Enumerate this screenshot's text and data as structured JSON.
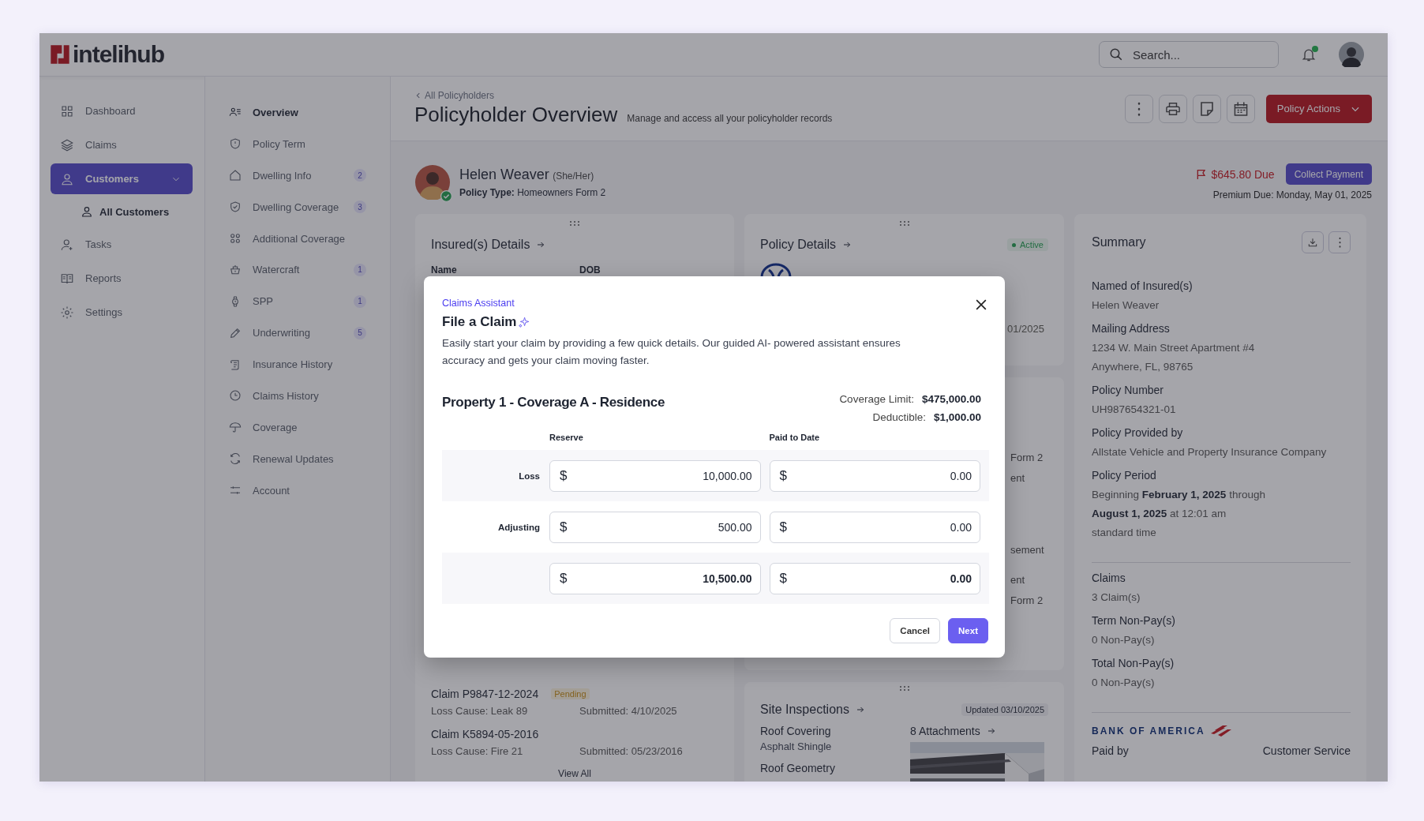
{
  "topbar": {
    "logo": "intelihub",
    "search": {
      "placeholder": "Search..."
    },
    "notifications": true
  },
  "sidebar": {
    "items": [
      {
        "label": "Dashboard",
        "selected": false,
        "expanded": false
      },
      {
        "label": "Claims",
        "selected": false,
        "expanded": false
      },
      {
        "label": "Customers",
        "selected": true,
        "expanded": true,
        "children": [
          {
            "label": "All Customers",
            "selected": true
          }
        ]
      },
      {
        "label": "Tasks",
        "selected": false,
        "expanded": false
      },
      {
        "label": "Reports",
        "selected": false,
        "expanded": false
      },
      {
        "label": "Settings",
        "selected": false,
        "expanded": false
      }
    ]
  },
  "subnav": {
    "items": [
      {
        "label": "Overview",
        "selected": true
      },
      {
        "label": "Policy Term",
        "selected": false
      },
      {
        "label": "Dwelling Info",
        "selected": false,
        "badge": "2"
      },
      {
        "label": "Dwelling Coverage",
        "selected": false,
        "badge": "3"
      },
      {
        "label": "Additional Coverage",
        "selected": false
      },
      {
        "label": "Watercraft",
        "selected": false,
        "badge": "1"
      },
      {
        "label": "SPP",
        "selected": false,
        "badge": "1"
      },
      {
        "label": "Underwriting",
        "selected": false,
        "badge": "5"
      },
      {
        "label": "Insurance History",
        "selected": false
      },
      {
        "label": "Claims History",
        "selected": false
      },
      {
        "label": "Coverage",
        "selected": false
      },
      {
        "label": "Renewal Updates",
        "selected": false
      },
      {
        "label": "Account",
        "selected": false
      }
    ]
  },
  "header": {
    "breadcrumb": "All Policyholders",
    "title": "Policyholder Overview",
    "subtitle": "Manage and access all your policyholder records",
    "primary_action": "Policy Actions"
  },
  "policyholder": {
    "name": "Helen Weaver",
    "pronouns": "(She/Her)",
    "verified": true,
    "policy_type_label": "Policy Type:",
    "policy_type": "Homeowners Form 2",
    "amount_due": "$645.80 Due",
    "payment_button": "Collect Payment",
    "premium_due": "Premium Due: Monday, May 01, 2025"
  },
  "insured_card": {
    "title": "Insured(s) Details",
    "columns": [
      "Name",
      "DOB"
    ],
    "claims": [
      {
        "id": "Claim P9847-12-2024",
        "status": "Pending",
        "loss_cause": "Loss Cause: Leak 89",
        "submitted": "Submitted: 4/10/2025"
      },
      {
        "id": "Claim K5894-05-2016",
        "loss_cause": "Loss Cause: Fire 21",
        "submitted": "Submitted: 05/23/2016"
      }
    ],
    "view_all": "View All"
  },
  "policy_card": {
    "title": "Policy Details",
    "status": "Active",
    "visible_text": [
      "01/2025"
    ]
  },
  "coverage_card": {
    "visible_groups": [
      [
        "Form 2",
        "ent"
      ],
      [
        "sement"
      ],
      [
        "ent",
        "Form 2"
      ]
    ]
  },
  "inspections_card": {
    "title": "Site Inspections",
    "updated": "Updated 03/10/2025",
    "items": [
      {
        "label": "Roof Covering",
        "value": "Asphalt Shingle"
      },
      {
        "label": "Roof Geometry"
      }
    ],
    "attachments": "8 Attachments"
  },
  "summary": {
    "title": "Summary",
    "fields": [
      {
        "label": "Named of Insured(s)",
        "lines": [
          "Helen Weaver"
        ]
      },
      {
        "label": "Mailing Address",
        "lines": [
          "1234 W. Main Street Apartment #4",
          "Anywhere, FL, 98765"
        ]
      },
      {
        "label": "Policy Number",
        "lines": [
          "UH987654321-01"
        ]
      },
      {
        "label": "Policy Provided by",
        "lines": [
          "Allstate Vehicle and Property Insurance Company"
        ]
      },
      {
        "label": "Policy Period",
        "lines": [
          "Beginning **February 1, 2025** through",
          "**August 1, 2025** at 12:01 am",
          "standard time"
        ]
      }
    ],
    "counts": [
      {
        "label": "Claims",
        "lines": [
          "3 Claim(s)"
        ]
      },
      {
        "label": "Term Non-Pay(s)",
        "lines": [
          "0 Non-Pay(s)"
        ]
      },
      {
        "label": "Total Non-Pay(s)",
        "lines": [
          "0 Non-Pay(s)"
        ]
      }
    ],
    "bank_logo": "BANK OF AMERICA",
    "footer": [
      "Paid by",
      "Customer Service"
    ]
  },
  "modal": {
    "eyebrow": "Claims Assistant",
    "title": "File a Claim",
    "description": "Easily start your claim by providing a few quick details. Our guided AI- powered assistant ensures accuracy and gets your claim moving faster.",
    "section_title": "Property 1 - Coverage A - Residence",
    "limits": [
      {
        "label": "Coverage Limit:",
        "value": "$475,000.00"
      },
      {
        "label": "Deductible:",
        "value": "$1,000.00"
      }
    ],
    "columns": [
      "Reserve",
      "Paid to Date"
    ],
    "rows": [
      {
        "kind": "entry",
        "label": "Loss",
        "cells": [
          {
            "prefix": "$",
            "value": "10,000.00"
          },
          {
            "prefix": "$",
            "value": "0.00"
          }
        ]
      },
      {
        "kind": "entry",
        "label": "Adjusting",
        "cells": [
          {
            "prefix": "$",
            "value": "500.00"
          },
          {
            "prefix": "$",
            "value": "0.00"
          }
        ]
      },
      {
        "kind": "total",
        "cells": [
          {
            "prefix": "$",
            "value": "10,500.00"
          },
          {
            "prefix": "$",
            "value": "0.00"
          }
        ]
      }
    ],
    "buttons": [
      {
        "label": "Cancel",
        "kind": "secondary"
      },
      {
        "label": "Next",
        "kind": "primary"
      }
    ]
  }
}
